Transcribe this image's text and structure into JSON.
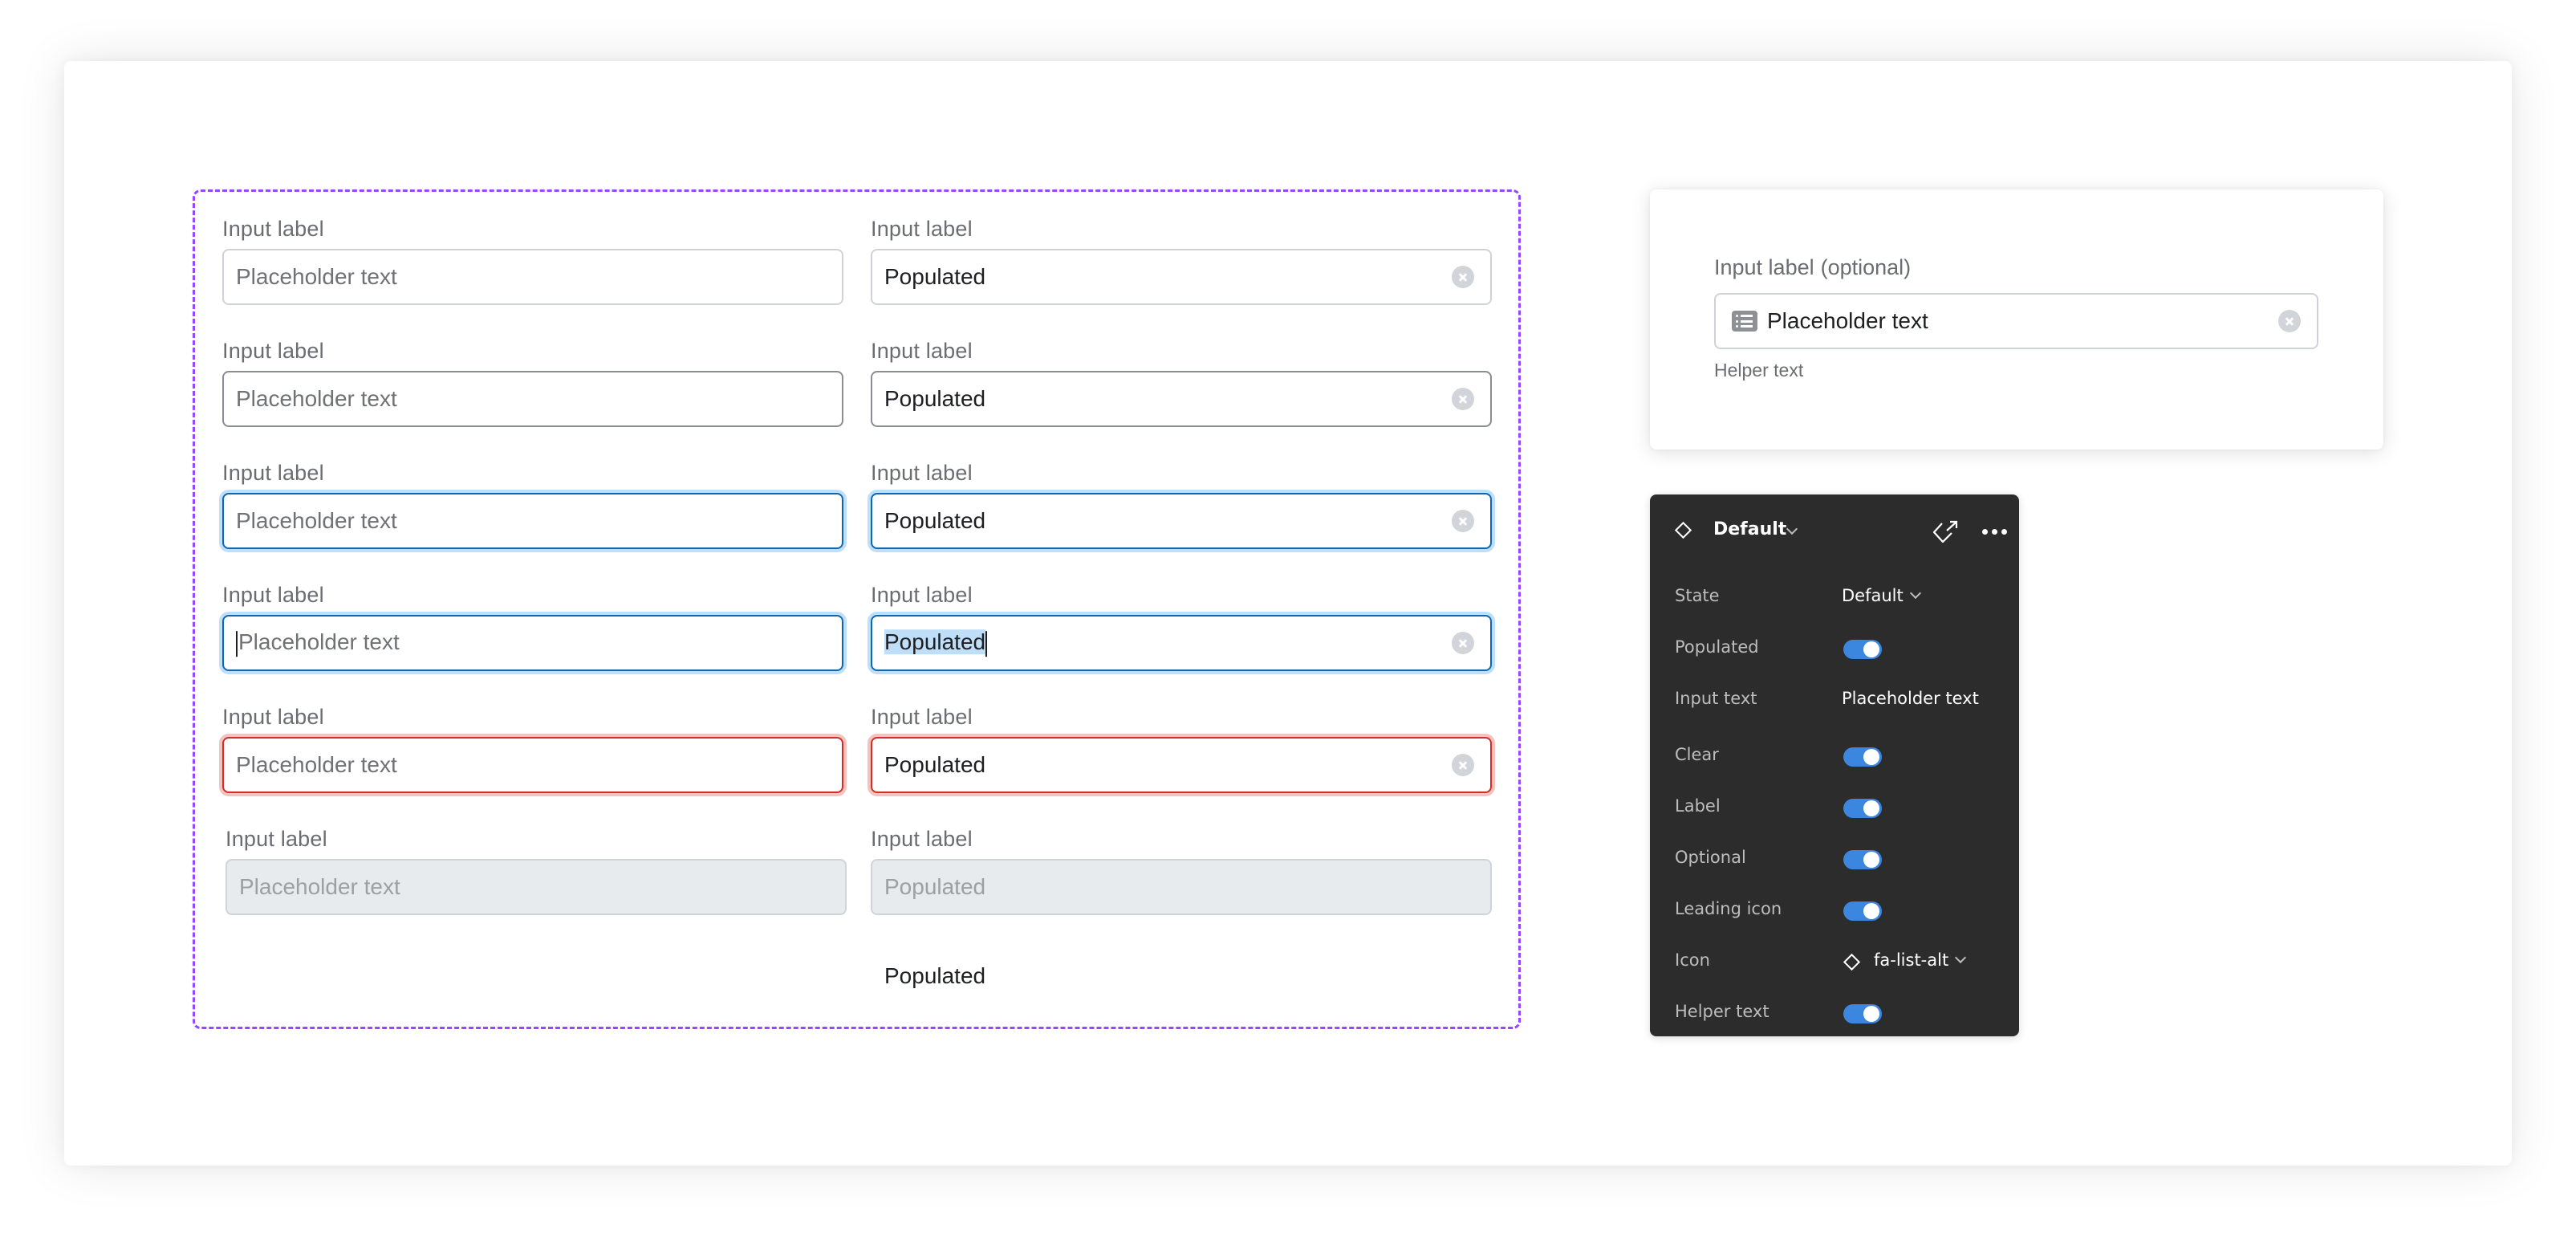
{
  "colors": {
    "frame_dashed": "#9747ff",
    "focus_border": "#0d67b5",
    "focus_ring": "#bfdef7",
    "error_border": "#d02e26",
    "error_ring": "#f4c2bf",
    "disabled_bg": "#e8ebee",
    "toggle_on": "#3b87e0",
    "panel_bg": "#2c2c2c"
  },
  "variants": {
    "rows": [
      {
        "state": "default",
        "left": {
          "label": "Input label",
          "text": "Placeholder text",
          "kind": "placeholder"
        },
        "right": {
          "label": "Input label",
          "text": "Populated",
          "kind": "value",
          "clear": true
        }
      },
      {
        "state": "hover",
        "left": {
          "label": "Input label",
          "text": "Placeholder text",
          "kind": "placeholder"
        },
        "right": {
          "label": "Input label",
          "text": "Populated",
          "kind": "value",
          "clear": true
        }
      },
      {
        "state": "focus",
        "left": {
          "label": "Input label",
          "text": "Placeholder text",
          "kind": "placeholder"
        },
        "right": {
          "label": "Input label",
          "text": "Populated",
          "kind": "value",
          "clear": true
        }
      },
      {
        "state": "typing",
        "left": {
          "label": "Input label",
          "text": "Placeholder text",
          "kind": "placeholder",
          "caret": "before"
        },
        "right": {
          "label": "Input label",
          "text": "Populated",
          "kind": "value",
          "clear": true,
          "selected": true,
          "caret": "after"
        }
      },
      {
        "state": "error",
        "left": {
          "label": "Input label",
          "text": "Placeholder text",
          "kind": "placeholder"
        },
        "right": {
          "label": "Input label",
          "text": "Populated",
          "kind": "value",
          "clear": true
        }
      },
      {
        "state": "disabled",
        "left": {
          "label": "Input label",
          "text": "Placeholder text",
          "kind": "placeholder"
        },
        "right": {
          "label": "Input label",
          "text": "Populated",
          "kind": "value",
          "clear": false
        }
      }
    ],
    "loose_text": "Populated"
  },
  "preview": {
    "label": "Input label",
    "optional": "(optional)",
    "input_text": "Placeholder text",
    "leading_icon": "list-alt-icon",
    "helper_text": "Helper text"
  },
  "properties_panel": {
    "component_icon": "component-diamond-icon",
    "variant_name": "Default",
    "header_actions": [
      "go-to-main-component-icon",
      "more-icon"
    ],
    "rows": [
      {
        "key": "State",
        "type": "dropdown",
        "value": "Default"
      },
      {
        "key": "Populated",
        "type": "toggle",
        "on": true
      },
      {
        "key": "Input text",
        "type": "text",
        "value": "Placeholder text"
      },
      {
        "key": "Clear",
        "type": "toggle",
        "on": true
      },
      {
        "key": "Label",
        "type": "toggle",
        "on": true
      },
      {
        "key": "Optional",
        "type": "toggle",
        "on": true
      },
      {
        "key": "Leading icon",
        "type": "toggle",
        "on": true
      },
      {
        "key": "Icon",
        "type": "instance-swap",
        "value": "fa-list-alt"
      },
      {
        "key": "Helper text",
        "type": "toggle",
        "on": true
      }
    ]
  }
}
